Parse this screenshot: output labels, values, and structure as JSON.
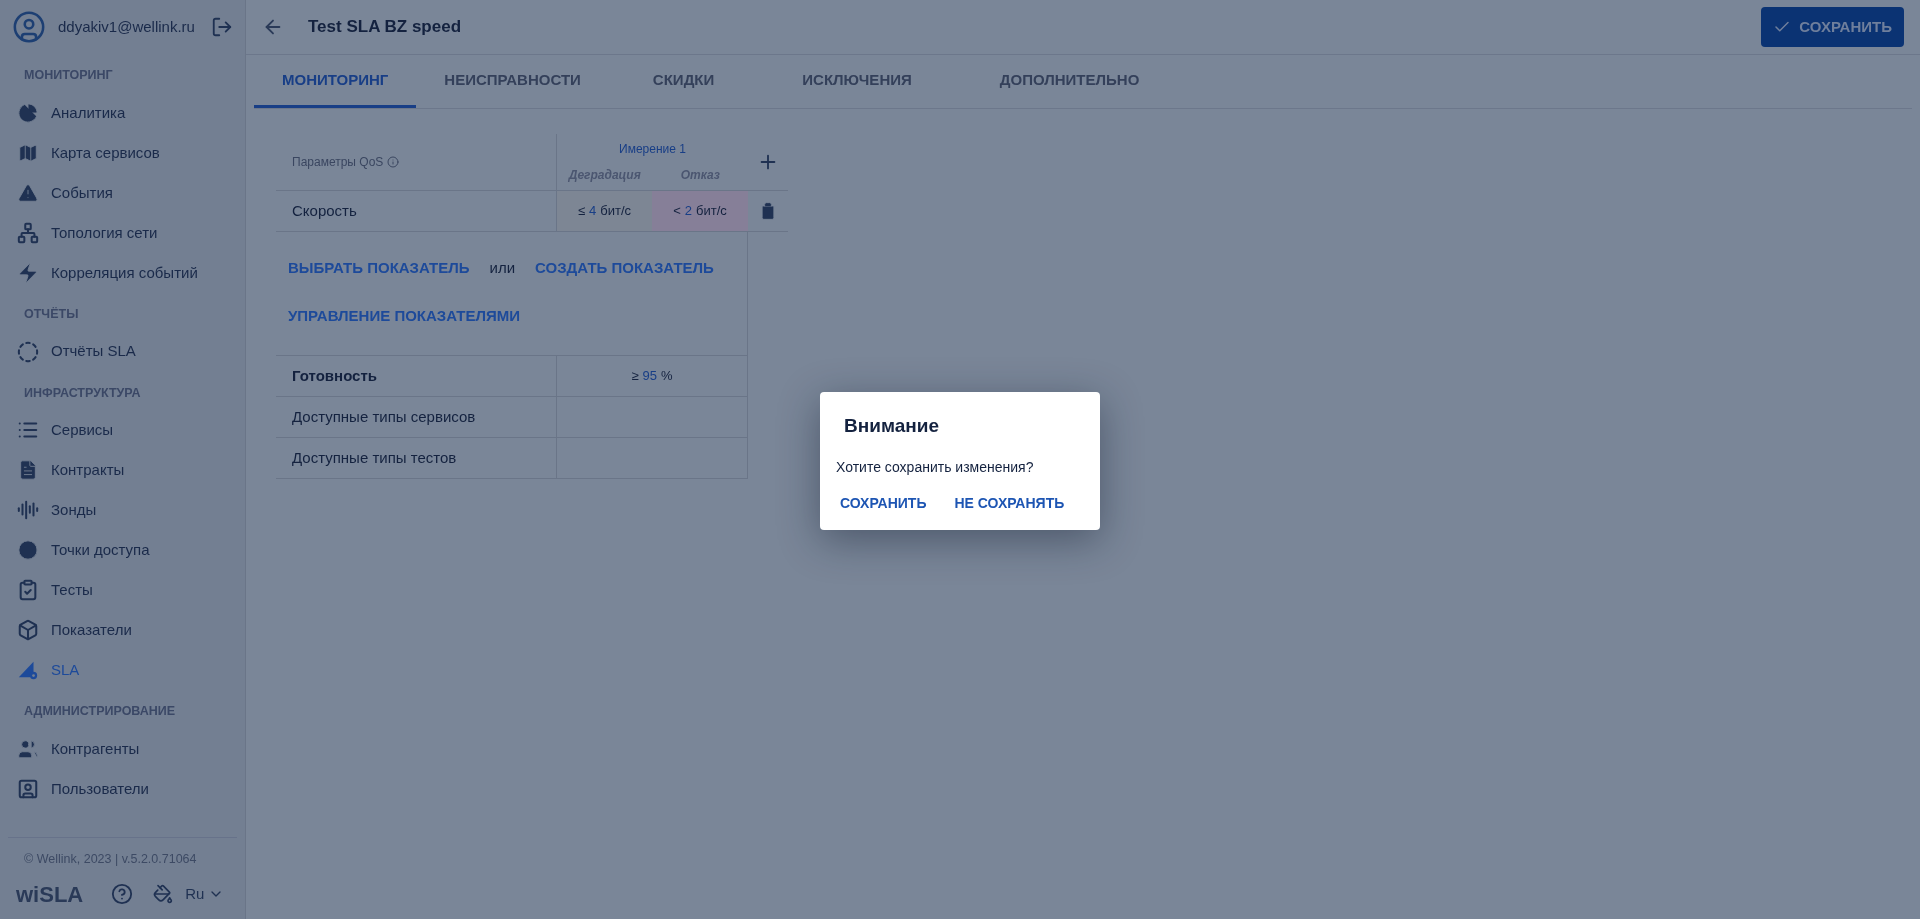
{
  "user": {
    "email": "ddyakiv1@wellink.ru"
  },
  "sidebar": {
    "sections": [
      {
        "title": "МОНИТОРИНГ",
        "items": [
          {
            "label": "Аналитика",
            "selected": false
          },
          {
            "label": "Карта сервисов",
            "selected": false
          },
          {
            "label": "События",
            "selected": false
          },
          {
            "label": "Топология сети",
            "selected": false
          },
          {
            "label": "Корреляция событий",
            "selected": false
          }
        ]
      },
      {
        "title": "ОТЧЁТЫ",
        "items": [
          {
            "label": "Отчёты SLA",
            "selected": false
          }
        ]
      },
      {
        "title": "ИНФРАСТРУКТУРА",
        "items": [
          {
            "label": "Сервисы",
            "selected": false
          },
          {
            "label": "Контракты",
            "selected": false
          },
          {
            "label": "Зонды",
            "selected": false
          },
          {
            "label": "Точки доступа",
            "selected": false
          },
          {
            "label": "Тесты",
            "selected": false
          },
          {
            "label": "Показатели",
            "selected": false
          },
          {
            "label": "SLA",
            "selected": true
          }
        ]
      },
      {
        "title": "АДМИНИСТРИРОВАНИЕ",
        "items": [
          {
            "label": "Контрагенты",
            "selected": false
          },
          {
            "label": "Пользователи",
            "selected": false
          }
        ]
      }
    ]
  },
  "footer": {
    "copyright": "© Wellink, 2023 | v.5.2.0.71064",
    "logo": "wiSLA",
    "language": "Ru"
  },
  "header": {
    "title": "Test SLA BZ speed",
    "save_button": "СОХРАНИТЬ"
  },
  "tabs": [
    {
      "label": "МОНИТОРИНГ",
      "selected": true
    },
    {
      "label": "НЕИСПРАВНОСТИ",
      "selected": false
    },
    {
      "label": "СКИДКИ",
      "selected": false
    },
    {
      "label": "ИСКЛЮЧЕНИЯ",
      "selected": false
    },
    {
      "label": "ДОПОЛНИТЕЛЬНО",
      "selected": false
    }
  ],
  "qos_table": {
    "params_heading": "Параметры QoS",
    "dimension": "Имерение 1",
    "subheadings": [
      "Деградация",
      "Отказ"
    ],
    "metrics": [
      {
        "name": "Скорость",
        "thresholds": [
          {
            "operator": "≤",
            "value": "4",
            "unit": "бит/с",
            "color": "#7d8694"
          },
          {
            "operator": "<",
            "value": "2",
            "unit": "бит/с",
            "color": "#867f98"
          }
        ]
      }
    ],
    "actions": {
      "select": "ВЫБРАТЬ ПОКАЗАТЕЛЬ",
      "or": "или",
      "create": "СОЗДАТЬ ПОКАЗАТЕЛЬ",
      "manage": "УПРАВЛЕНИЕ ПОКАЗАТЕЛЯМИ"
    },
    "availability": {
      "name": "Готовность",
      "operator": "≥",
      "value": "95",
      "unit": "%"
    },
    "extra_rows": [
      {
        "name": "Доступные типы сервисов"
      },
      {
        "name": "Доступные типы тестов"
      }
    ]
  },
  "dialog": {
    "title": "Внимание",
    "message": "Хотите сохранить изменения?",
    "buttons": [
      "СОХРАНИТЬ",
      "НЕ СОХРАНЯТЬ"
    ]
  }
}
